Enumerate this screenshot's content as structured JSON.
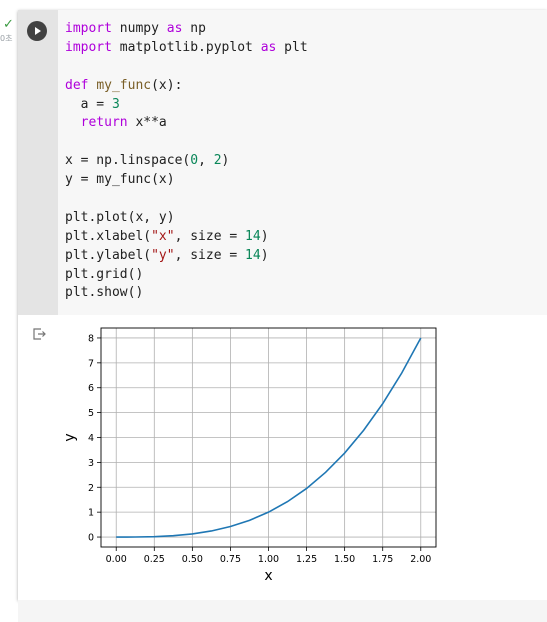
{
  "cell": {
    "status_check": "✓",
    "exec_time": "0초"
  },
  "code_lines": [
    [
      {
        "t": "import",
        "c": "kw"
      },
      {
        "t": " numpy "
      },
      {
        "t": "as",
        "c": "kw"
      },
      {
        "t": " np"
      }
    ],
    [
      {
        "t": "import",
        "c": "kw"
      },
      {
        "t": " matplotlib.pyplot "
      },
      {
        "t": "as",
        "c": "kw"
      },
      {
        "t": " plt"
      }
    ],
    [],
    [
      {
        "t": "def",
        "c": "kw"
      },
      {
        "t": " "
      },
      {
        "t": "my_func",
        "c": "fn"
      },
      {
        "t": "(x):"
      }
    ],
    [
      {
        "t": "  a = "
      },
      {
        "t": "3",
        "c": "num"
      }
    ],
    [
      {
        "t": "  "
      },
      {
        "t": "return",
        "c": "kw"
      },
      {
        "t": " x**a"
      }
    ],
    [],
    [
      {
        "t": "x = np.linspace("
      },
      {
        "t": "0",
        "c": "num"
      },
      {
        "t": ", "
      },
      {
        "t": "2",
        "c": "num"
      },
      {
        "t": ")"
      }
    ],
    [
      {
        "t": "y = my_func(x)"
      }
    ],
    [],
    [
      {
        "t": "plt.plot(x, y)"
      }
    ],
    [
      {
        "t": "plt.xlabel("
      },
      {
        "t": "\"x\"",
        "c": "str"
      },
      {
        "t": ", size = "
      },
      {
        "t": "14",
        "c": "num"
      },
      {
        "t": ")"
      }
    ],
    [
      {
        "t": "plt.ylabel("
      },
      {
        "t": "\"y\"",
        "c": "str"
      },
      {
        "t": ", size = "
      },
      {
        "t": "14",
        "c": "num"
      },
      {
        "t": ")"
      }
    ],
    [
      {
        "t": "plt.grid()"
      }
    ],
    [
      {
        "t": "plt.show()"
      }
    ]
  ],
  "chart_data": {
    "type": "line",
    "title": "",
    "xlabel": "x",
    "ylabel": "y",
    "xlim": [
      -0.1,
      2.1
    ],
    "ylim": [
      -0.4,
      8.4
    ],
    "xticks": [
      "0.00",
      "0.25",
      "0.50",
      "0.75",
      "1.00",
      "1.25",
      "1.50",
      "1.75",
      "2.00"
    ],
    "yticks": [
      "0",
      "1",
      "2",
      "3",
      "4",
      "5",
      "6",
      "7",
      "8"
    ],
    "grid": true,
    "line_color": "#1f77b4",
    "series": [
      {
        "x": [
          0,
          0.125,
          0.25,
          0.375,
          0.5,
          0.625,
          0.75,
          0.875,
          1.0,
          1.125,
          1.25,
          1.375,
          1.5,
          1.625,
          1.75,
          1.875,
          2.0
        ],
        "values": [
          0,
          0.002,
          0.016,
          0.053,
          0.125,
          0.244,
          0.422,
          0.67,
          1.0,
          1.424,
          1.953,
          2.6,
          3.375,
          4.291,
          5.359,
          6.592,
          8.0
        ]
      }
    ]
  }
}
